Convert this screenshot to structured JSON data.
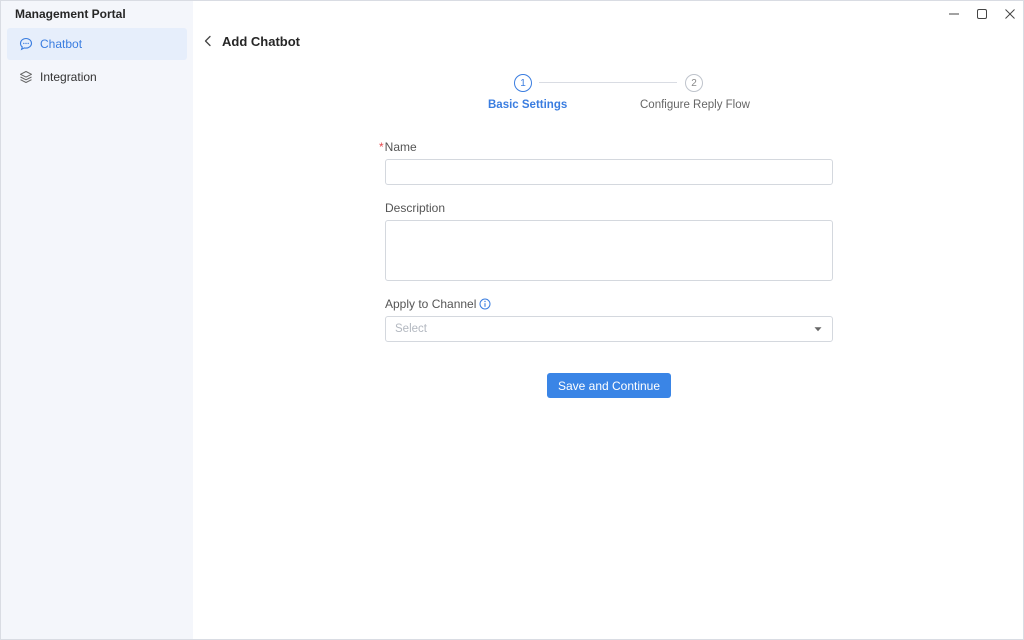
{
  "app": {
    "title": "Management Portal"
  },
  "sidebar": {
    "items": [
      {
        "label": "Chatbot",
        "icon": "chat-bubble-icon",
        "active": true
      },
      {
        "label": "Integration",
        "icon": "layers-icon",
        "active": false
      }
    ]
  },
  "window_controls": [
    "minimize-icon",
    "maximize-icon",
    "close-icon"
  ],
  "header": {
    "title": "Add Chatbot"
  },
  "steps": [
    {
      "number": "1",
      "label": "Basic Settings",
      "state": "active"
    },
    {
      "number": "2",
      "label": "Configure Reply Flow",
      "state": "pending"
    }
  ],
  "form": {
    "name": {
      "label": "Name",
      "required": "*",
      "value": "",
      "placeholder": ""
    },
    "description": {
      "label": "Description",
      "value": "",
      "placeholder": ""
    },
    "channel": {
      "label": "Apply to Channel",
      "placeholder": "Select"
    },
    "submit_label": "Save and Continue"
  },
  "colors": {
    "accent": "#3a85e6",
    "sidebar_bg": "#f4f6fb",
    "required": "#e5484d"
  }
}
